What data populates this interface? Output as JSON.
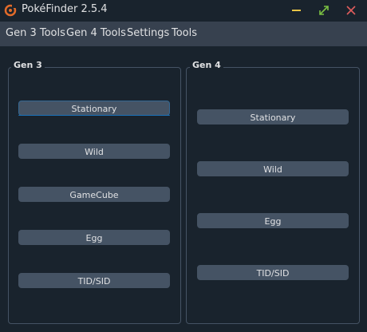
{
  "window": {
    "title": "PokéFinder 2.5.4",
    "icons": {
      "app": "pokefinder-logo-icon",
      "minimize": "minimize-icon",
      "maximize": "maximize-icon",
      "close": "close-icon"
    },
    "colors": {
      "minimize": "#e8c547",
      "maximize": "#7bc043",
      "close": "#e05d5d",
      "logo": "#e26b2a"
    }
  },
  "menubar": {
    "items": [
      {
        "label": "Gen 3 Tools"
      },
      {
        "label": "Gen 4 Tools"
      },
      {
        "label": "Settings"
      },
      {
        "label": "Tools"
      }
    ]
  },
  "gen3": {
    "title": "Gen 3",
    "buttons": [
      {
        "label": "Stationary"
      },
      {
        "label": "Wild"
      },
      {
        "label": "GameCube"
      },
      {
        "label": "Egg"
      },
      {
        "label": "TID/SID"
      }
    ]
  },
  "gen4": {
    "title": "Gen 4",
    "buttons": [
      {
        "label": "Stationary"
      },
      {
        "label": "Wild"
      },
      {
        "label": "Egg"
      },
      {
        "label": "TID/SID"
      }
    ]
  }
}
